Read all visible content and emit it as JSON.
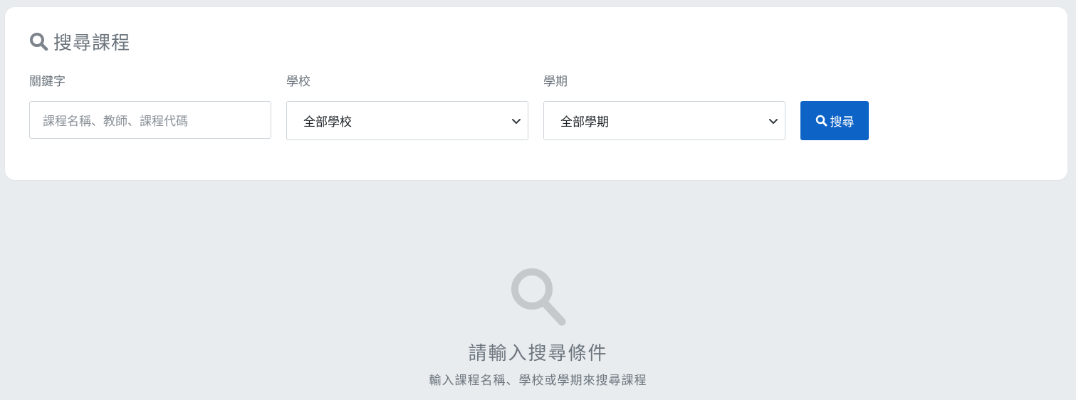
{
  "search_card": {
    "title": "搜尋課程",
    "title_icon": "search-icon",
    "keyword": {
      "label": "關鍵字",
      "placeholder": "課程名稱、教師、課程代碼",
      "value": ""
    },
    "school": {
      "label": "學校",
      "selected": "全部學校"
    },
    "semester": {
      "label": "學期",
      "selected": "全部學期"
    },
    "search_button": {
      "label": "搜尋",
      "icon": "search-icon"
    }
  },
  "empty_state": {
    "icon": "search-icon",
    "title": "請輸入搜尋條件",
    "subtitle": "輸入課程名稱、學校或學期來搜尋課程"
  },
  "colors": {
    "background": "#e9ecef",
    "card": "#ffffff",
    "muted_text": "#6c757d",
    "primary_button": "#0d63c6",
    "empty_icon": "#c6c9cc"
  }
}
